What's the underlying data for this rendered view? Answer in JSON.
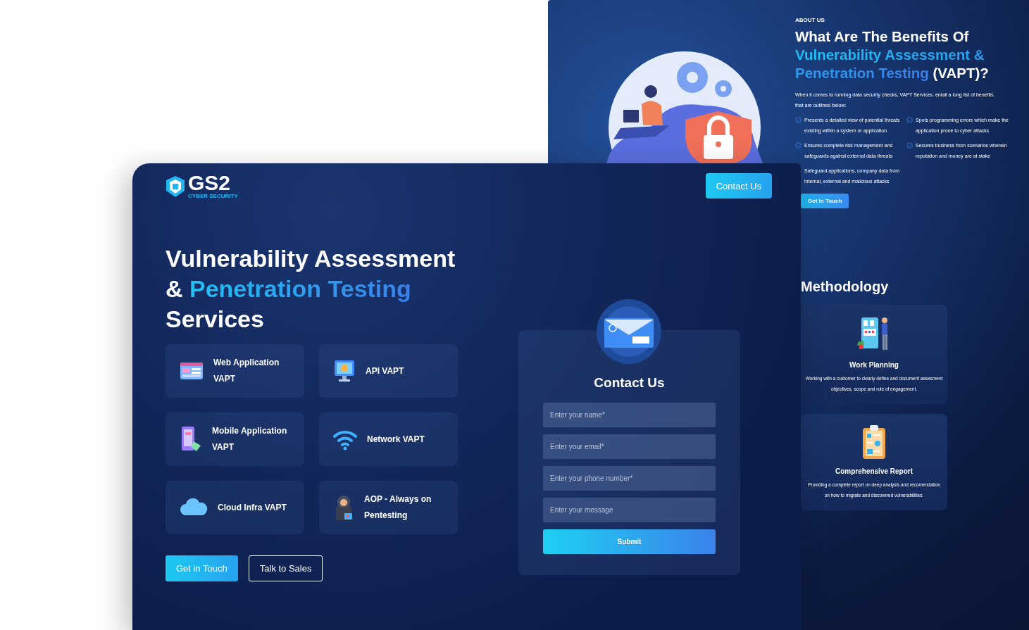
{
  "about_page": {
    "eyebrow": "ABOUT US",
    "heading": [
      {
        "text": "What Are The Benefits Of ",
        "accent": false
      },
      {
        "text": "Vulnerability Assessment & Penetration Testing",
        "accent": true
      },
      {
        "text": " (VAPT)?",
        "accent": false
      }
    ],
    "intro": "When it comes to running data security checks, VAPT Services. entail a long list of benefits that are outlined below:",
    "benefits": [
      {
        "text": "Presents a detailed view of potential threats existing within a system or application",
        "checked": true
      },
      {
        "text": "Spots programming errors which make the application prone to cyber attacks",
        "checked": true
      },
      {
        "text": "Ensures complete risk management and safeguards against external data threats",
        "checked": true
      },
      {
        "text": "Secures business from scenarios wherein reputation and money are at stake",
        "checked": true
      },
      {
        "text": "Safeguard applications, company data from internal, external and malicious attacks",
        "checked": false
      }
    ],
    "cta": "Get in Touch",
    "methodology": {
      "title": "Methodology",
      "steps": [
        {
          "kind": "planning",
          "title": "Work Planning",
          "text": "Working with a customer to clearly define and document assesment objectives, scope and rule of engagement."
        },
        {
          "kind": "report",
          "title": "Comprehensive Report",
          "text": "Providing a complete report on deep analysis and recomendation on how to migrate and discovered vulnerabilities."
        }
      ]
    }
  },
  "landing_page": {
    "logo": {
      "name": "GS2",
      "tagline": "CYBER SECURITY"
    },
    "contact_button": "Contact Us",
    "heading": [
      {
        "text": "Vulnerability Assessment & ",
        "accent": false
      },
      {
        "text": "Penetration Testing",
        "accent": true
      },
      {
        "text": " Services",
        "accent": false
      }
    ],
    "services": [
      {
        "kind": "web",
        "label": "Web Application VAPT"
      },
      {
        "kind": "api",
        "label": "API VAPT"
      },
      {
        "kind": "mobile",
        "label": "Mobile Application VAPT"
      },
      {
        "kind": "network",
        "label": "Network VAPT"
      },
      {
        "kind": "cloud",
        "label": "Cloud Infra VAPT"
      },
      {
        "kind": "person",
        "label": "AOP - Always on Pentesting"
      }
    ],
    "buttons": [
      {
        "kind": "primary",
        "label": "Get in Touch"
      },
      {
        "kind": "outline",
        "label": "Talk to Sales"
      }
    ],
    "form": {
      "title": "Contact Us",
      "fields": [
        {
          "placeholder": "Enter your name*"
        },
        {
          "placeholder": "Enter your email*"
        },
        {
          "placeholder": "Enter your phone number*"
        },
        {
          "placeholder": "Enter your message"
        }
      ],
      "submit": "Submit"
    }
  }
}
